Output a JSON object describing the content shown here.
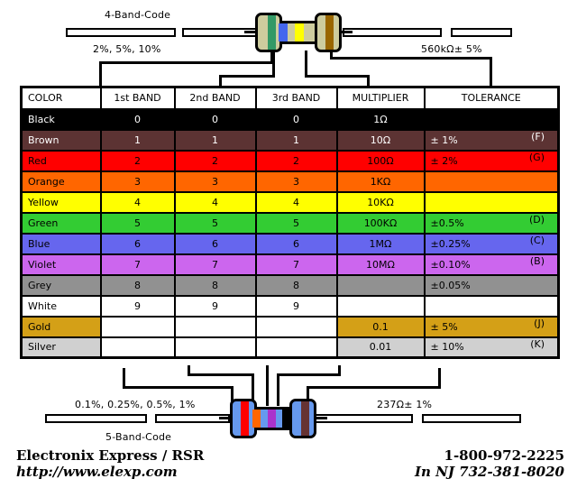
{
  "top_diagram": {
    "title": "4-Band-Code",
    "tolerance_note": "2%, 5%, 10%",
    "value_note": "560kΩ± 5%",
    "resistor": {
      "body_color": "#CDCC9E",
      "bands": [
        "#339966",
        "#4466EE",
        "#FFFF00",
        "#996600"
      ],
      "band_names": [
        "green",
        "blue",
        "yellow",
        "brown"
      ]
    }
  },
  "bottom_diagram": {
    "title": "5-Band-Code",
    "tolerance_note": "0.1%, 0.25%, 0.5%, 1%",
    "value_note": "237Ω± 1%",
    "resistor": {
      "body_color": "#6699EE",
      "bands": [
        "#FF0000",
        "#FF6600",
        "#AA33CC",
        "#000000",
        "#663333"
      ],
      "band_names": [
        "red",
        "orange",
        "violet",
        "black",
        "brown"
      ]
    }
  },
  "table": {
    "headers": [
      "COLOR",
      "1st BAND",
      "2nd BAND",
      "3rd BAND",
      "MULTIPLIER",
      "TOLERANCE"
    ],
    "rows": [
      {
        "color": "Black",
        "bg": "#000000",
        "fg": "#FFFFFF",
        "band1": "0",
        "band2": "0",
        "band3": "0",
        "multiplier": "1Ω",
        "tolerance": "",
        "letter": "",
        "blank_bands": false
      },
      {
        "color": "Brown",
        "bg": "#5C3333",
        "fg": "#FFFFFF",
        "band1": "1",
        "band2": "1",
        "band3": "1",
        "multiplier": "10Ω",
        "tolerance": "±   1%",
        "letter": "(F)",
        "blank_bands": false
      },
      {
        "color": "Red",
        "bg": "#FF0000",
        "fg": "#000000",
        "band1": "2",
        "band2": "2",
        "band3": "2",
        "multiplier": "100Ω",
        "tolerance": "±   2%",
        "letter": "(G)",
        "blank_bands": false
      },
      {
        "color": "Orange",
        "bg": "#FF6600",
        "fg": "#000000",
        "band1": "3",
        "band2": "3",
        "band3": "3",
        "multiplier": "1KΩ",
        "tolerance": "",
        "letter": "",
        "blank_bands": false
      },
      {
        "color": "Yellow",
        "bg": "#FFFF00",
        "fg": "#000000",
        "band1": "4",
        "band2": "4",
        "band3": "4",
        "multiplier": "10KΩ",
        "tolerance": "",
        "letter": "",
        "blank_bands": false
      },
      {
        "color": "Green",
        "bg": "#33CC33",
        "fg": "#000000",
        "band1": "5",
        "band2": "5",
        "band3": "5",
        "multiplier": "100KΩ",
        "tolerance": "±0.5%",
        "letter": "(D)",
        "blank_bands": false
      },
      {
        "color": "Blue",
        "bg": "#6666EE",
        "fg": "#000000",
        "band1": "6",
        "band2": "6",
        "band3": "6",
        "multiplier": "1MΩ",
        "tolerance": "±0.25%",
        "letter": "(C)",
        "blank_bands": false
      },
      {
        "color": "Violet",
        "bg": "#CC66EE",
        "fg": "#000000",
        "band1": "7",
        "band2": "7",
        "band3": "7",
        "multiplier": "10MΩ",
        "tolerance": "±0.10%",
        "letter": "(B)",
        "blank_bands": false
      },
      {
        "color": "Grey",
        "bg": "#919191",
        "fg": "#000000",
        "band1": "8",
        "band2": "8",
        "band3": "8",
        "multiplier": "",
        "tolerance": "±0.05%",
        "letter": "",
        "blank_bands": false
      },
      {
        "color": "White",
        "bg": "#FFFFFF",
        "fg": "#000000",
        "band1": "9",
        "band2": "9",
        "band3": "9",
        "multiplier": "",
        "tolerance": "",
        "letter": "",
        "blank_bands": false
      },
      {
        "color": "Gold",
        "bg": "#D4A017",
        "fg": "#000000",
        "band1": "",
        "band2": "",
        "band3": "",
        "multiplier": "0.1",
        "tolerance": "±   5%",
        "letter": "(J)",
        "blank_bands": true
      },
      {
        "color": "Silver",
        "bg": "#D0D0D0",
        "fg": "#000000",
        "band1": "",
        "band2": "",
        "band3": "",
        "multiplier": "0.01",
        "tolerance": "±  10%",
        "letter": "(K)",
        "blank_bands": true
      }
    ]
  },
  "footer": {
    "company": "Electronix  Express / RSR",
    "website": "http://www.elexp.com",
    "phone": "1-800-972-2225",
    "phone_nj": "In  NJ  732-381-8020"
  }
}
